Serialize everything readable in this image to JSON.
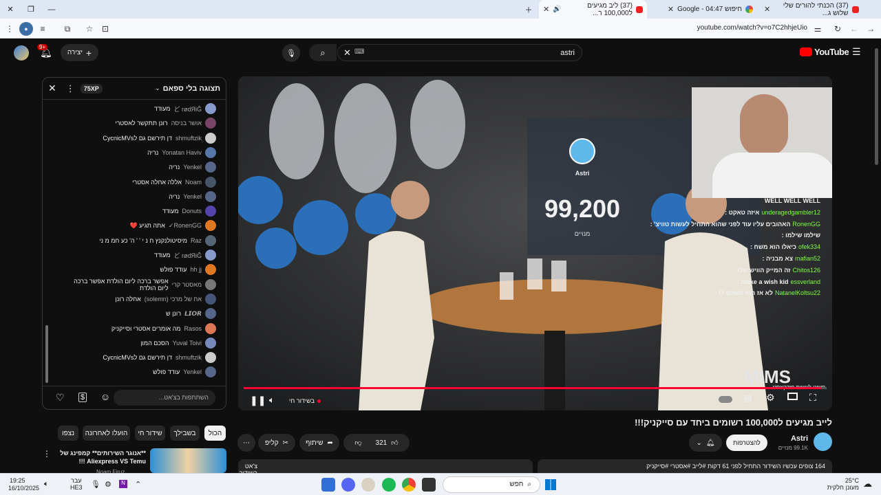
{
  "browser": {
    "tabs": [
      {
        "label": "(37) ליב מגיעים ל100,000 ר...",
        "time": "04:47"
      },
      {
        "label": "חיפוש Google - 04:47"
      },
      {
        "label": "(37) הכנתי להורים שלי שלוש ג..."
      }
    ],
    "url": "youtube.com/watch?v=o7C2hhjeUio"
  },
  "yt": {
    "create_label": "יצירה",
    "notif_count": "9+",
    "search_value": "astri",
    "logo": "YouTube"
  },
  "chat": {
    "mode_label": "תצוגה בלי ספאם",
    "xp_badge": "75XP",
    "input_placeholder": "השתתפות בצ'אט...",
    "messages": [
      {
        "name": "ど rødЯiĜ",
        "text": "מעודד",
        "color": "#8899cc"
      },
      {
        "name": "אושר בניסה",
        "text": "רונן תתקשר לאסטרי",
        "color": "#774466"
      },
      {
        "name": "shmuftzik",
        "text": "דן תירשם גם לCycnicMVs",
        "color": "#cccccc"
      },
      {
        "name": "Yonatan Haviv",
        "text": "נריה",
        "color": "#5577aa"
      },
      {
        "name": "Yenkel",
        "text": "נריה",
        "color": "#556688"
      },
      {
        "name": "Noam",
        "text": "אללה אחלה אסטרי",
        "color": "#445566"
      },
      {
        "name": "Yenkel",
        "text": "נריה",
        "color": "#556688"
      },
      {
        "name": "Donuts",
        "text": "מעודד",
        "color": "#5544aa"
      },
      {
        "name": "RonenGG✓",
        "text": "אתה תגיע ❤️",
        "color": "#dd7722"
      },
      {
        "name": "Raz",
        "text": "מיסיטולנקנץ ח נ י ' ' ה' כע חמ מ ני",
        "color": "#556677"
      },
      {
        "name": "ど rødЯiĜ",
        "text": "מעודד",
        "color": "#8899cc"
      },
      {
        "name": "hh jj",
        "text": "עודד פולש",
        "color": "#dd7722"
      },
      {
        "name": "מאסטר קרי",
        "text": "אפשר ברכה ליום הולדת אפשר ברכה ליום הולדת",
        "color": "#777777"
      },
      {
        "name": "אח של מרכי (solemn)",
        "text": "אחלה רונן",
        "color": "#445577"
      },
      {
        "name": "𝙇𝙄𝙊𝙍",
        "text": "רונן ש",
        "color": "#556688"
      },
      {
        "name": "Rasos",
        "text": "מה אומרים אסטרי וסייקניק",
        "color": "#dd7755"
      },
      {
        "name": "Yuval Toivi",
        "text": "הסכם המון",
        "color": "#7788bb"
      },
      {
        "name": "shmuftzik",
        "text": "דן תירשם גם לCycnicMVs",
        "color": "#cccccc"
      },
      {
        "name": "Yenkel",
        "text": "עודד פולש",
        "color": "#556688"
      }
    ]
  },
  "video": {
    "channel_overlay": "Astri",
    "sub_counter": "99,200",
    "sub_label": "מנויים",
    "overlay_chat": [
      {
        "name": "",
        "text": "WELL WELL WELL"
      },
      {
        "name": "underagedgambler12",
        "text": "איזה טאקט :"
      },
      {
        "name": "RonenGG",
        "text": "האהובים עליו עוד לפני שהוא התחיל לעשות טוויצ' :"
      },
      {
        "name": "",
        "text": "שילמו שילמו :"
      },
      {
        "name": "ofek334",
        "text": "כיאלו הוא משח :"
      },
      {
        "name": "mafian52",
        "text": "צא מבניה :"
      },
      {
        "name": "Chitos126",
        "text": "זה המייק הוויש שלו :"
      },
      {
        "name": "essverland",
        "text": "make a wish kid :"
      },
      {
        "name": "NatanelKoltsu22",
        "text": "לא אז הוא משלם לו :"
      }
    ],
    "watermark": "MIMS",
    "watermark_sub": "פשוט לעשות פודקאסט",
    "live_label": "בשידור חי",
    "progress": 0.99
  },
  "below": {
    "title": "לייב מגיעים ל100,000 רשומים ביחד עם סייקניק!!!",
    "channel": "Astri",
    "subs": "99.1K מנויים",
    "join_label": "להצטרפות",
    "likes": "321",
    "share_label": "שיתוף",
    "clip_label": "קליפ",
    "desc": "164 צופים עכשיו  השידור התחיל לפני 61 דקות  #לייב #אסטרי #סייקניק",
    "live_chat_label": "צ'אט בשידור חי"
  },
  "chips": [
    "הכול",
    "בשבילך",
    "שידור חי",
    "הועלו לאחרונה",
    "נצפו"
  ],
  "rec": {
    "title": "**אנוגר השירותים** קמפינג של Aliexpress VS Temu !!!",
    "channel": "Noam Firuz"
  },
  "taskbar": {
    "time": "19:25",
    "date": "16/10/2025",
    "lang": "עבר",
    "lang2": "HE3",
    "search": "חפש",
    "temp": "25°C",
    "weather": "מעונן חלקית"
  }
}
